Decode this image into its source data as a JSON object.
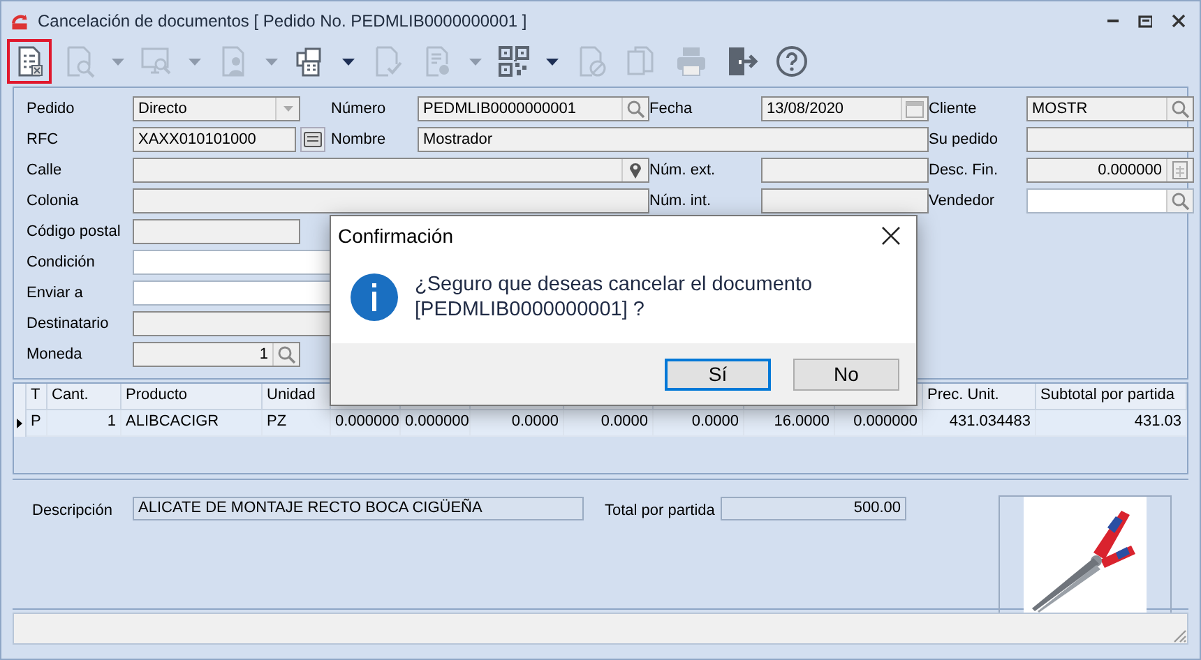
{
  "window": {
    "title": "Cancelación de documentos [ Pedido No. PEDMLIB0000000001 ]"
  },
  "toolbar": [
    {
      "kind": "document-list",
      "disabled": false,
      "selected": true,
      "dropdown": false
    },
    {
      "kind": "document-search",
      "disabled": true,
      "selected": false,
      "dropdown": true
    },
    {
      "kind": "monitor-search",
      "disabled": true,
      "selected": false,
      "dropdown": true
    },
    {
      "kind": "document-person",
      "disabled": true,
      "selected": false,
      "dropdown": true
    },
    {
      "kind": "buildings",
      "disabled": false,
      "selected": false,
      "dropdown": true
    },
    {
      "kind": "document-check",
      "disabled": true,
      "selected": false,
      "dropdown": false
    },
    {
      "kind": "document-gear",
      "disabled": true,
      "selected": false,
      "dropdown": true
    },
    {
      "kind": "qr-code",
      "disabled": false,
      "selected": false,
      "dropdown": true
    },
    {
      "kind": "document-blocked",
      "disabled": true,
      "selected": false,
      "dropdown": false
    },
    {
      "kind": "copy",
      "disabled": true,
      "selected": false,
      "dropdown": false
    },
    {
      "kind": "printer",
      "disabled": true,
      "selected": false,
      "dropdown": false
    },
    {
      "kind": "exit",
      "disabled": false,
      "selected": false,
      "dropdown": false
    },
    {
      "kind": "help",
      "disabled": false,
      "selected": false,
      "dropdown": false
    }
  ],
  "form": [
    {
      "label": "Pedido",
      "value": "Directo",
      "kind": "combo",
      "disabled": true
    },
    {
      "label": "Número",
      "value": "PEDMLIB0000000001",
      "kind": "text",
      "disabled": true
    },
    {
      "label": "Fecha",
      "value": "13/08/2020",
      "kind": "text",
      "disabled": true
    },
    {
      "label": "Cliente",
      "value": "MOSTR",
      "kind": "text",
      "disabled": true
    },
    {
      "label": "RFC",
      "value": "XAXX010101000",
      "kind": "text",
      "disabled": true
    },
    {
      "label": "Nombre",
      "value": "Mostrador",
      "kind": "text",
      "disabled": true
    },
    {
      "label": "Su pedido",
      "kind": "text",
      "disabled": true
    },
    {
      "label": "Calle",
      "kind": "text",
      "disabled": true
    },
    {
      "label": "Núm. ext.",
      "kind": "text",
      "disabled": true
    },
    {
      "label": "Desc. Fin.",
      "value": "0.000000",
      "kind": "number",
      "disabled": true
    },
    {
      "label": "Colonia",
      "kind": "text",
      "disabled": true
    },
    {
      "label": "Núm. int.",
      "kind": "text",
      "disabled": true
    },
    {
      "label": "Vendedor",
      "kind": "text",
      "disabled": false
    },
    {
      "label": "Código postal",
      "kind": "text",
      "disabled": true
    },
    {
      "label": "Condición",
      "kind": "text",
      "disabled": false
    },
    {
      "label": "Enviar a",
      "kind": "text",
      "disabled": false
    },
    {
      "label": "Destinatario",
      "kind": "text",
      "disabled": true
    },
    {
      "label": "Moneda",
      "value": "1",
      "kind": "number",
      "disabled": true
    }
  ],
  "table": {
    "columns": [
      {
        "label": "T"
      },
      {
        "label": "Cant."
      },
      {
        "label": "Producto"
      },
      {
        "label": "Unidad"
      },
      {},
      {},
      {},
      {},
      {},
      {},
      {},
      {
        "label": "Prec. Unit."
      },
      {
        "label": "Subtotal por partida"
      }
    ],
    "rows": [
      {
        "selected": true,
        "cells": [
          "P",
          "1",
          "ALIBCACIGR",
          "PZ",
          "0.000000",
          "0.000000",
          "0.0000",
          "0.0000",
          "0.0000",
          "16.0000",
          "0.000000",
          "431.034483",
          "431.03"
        ]
      }
    ]
  },
  "detail": {
    "description_label": "Descripción",
    "description": "ALICATE DE MONTAJE RECTO BOCA CIGÜEÑA",
    "total_label": "Total por partida",
    "total": "500.00"
  },
  "dialog": {
    "title": "Confirmación",
    "message": "¿Seguro que deseas cancelar el documento [PEDMLIB0000000001] ?",
    "buttons": [
      {
        "label": "Sí",
        "default": true
      },
      {
        "label": "No",
        "default": false
      }
    ]
  }
}
